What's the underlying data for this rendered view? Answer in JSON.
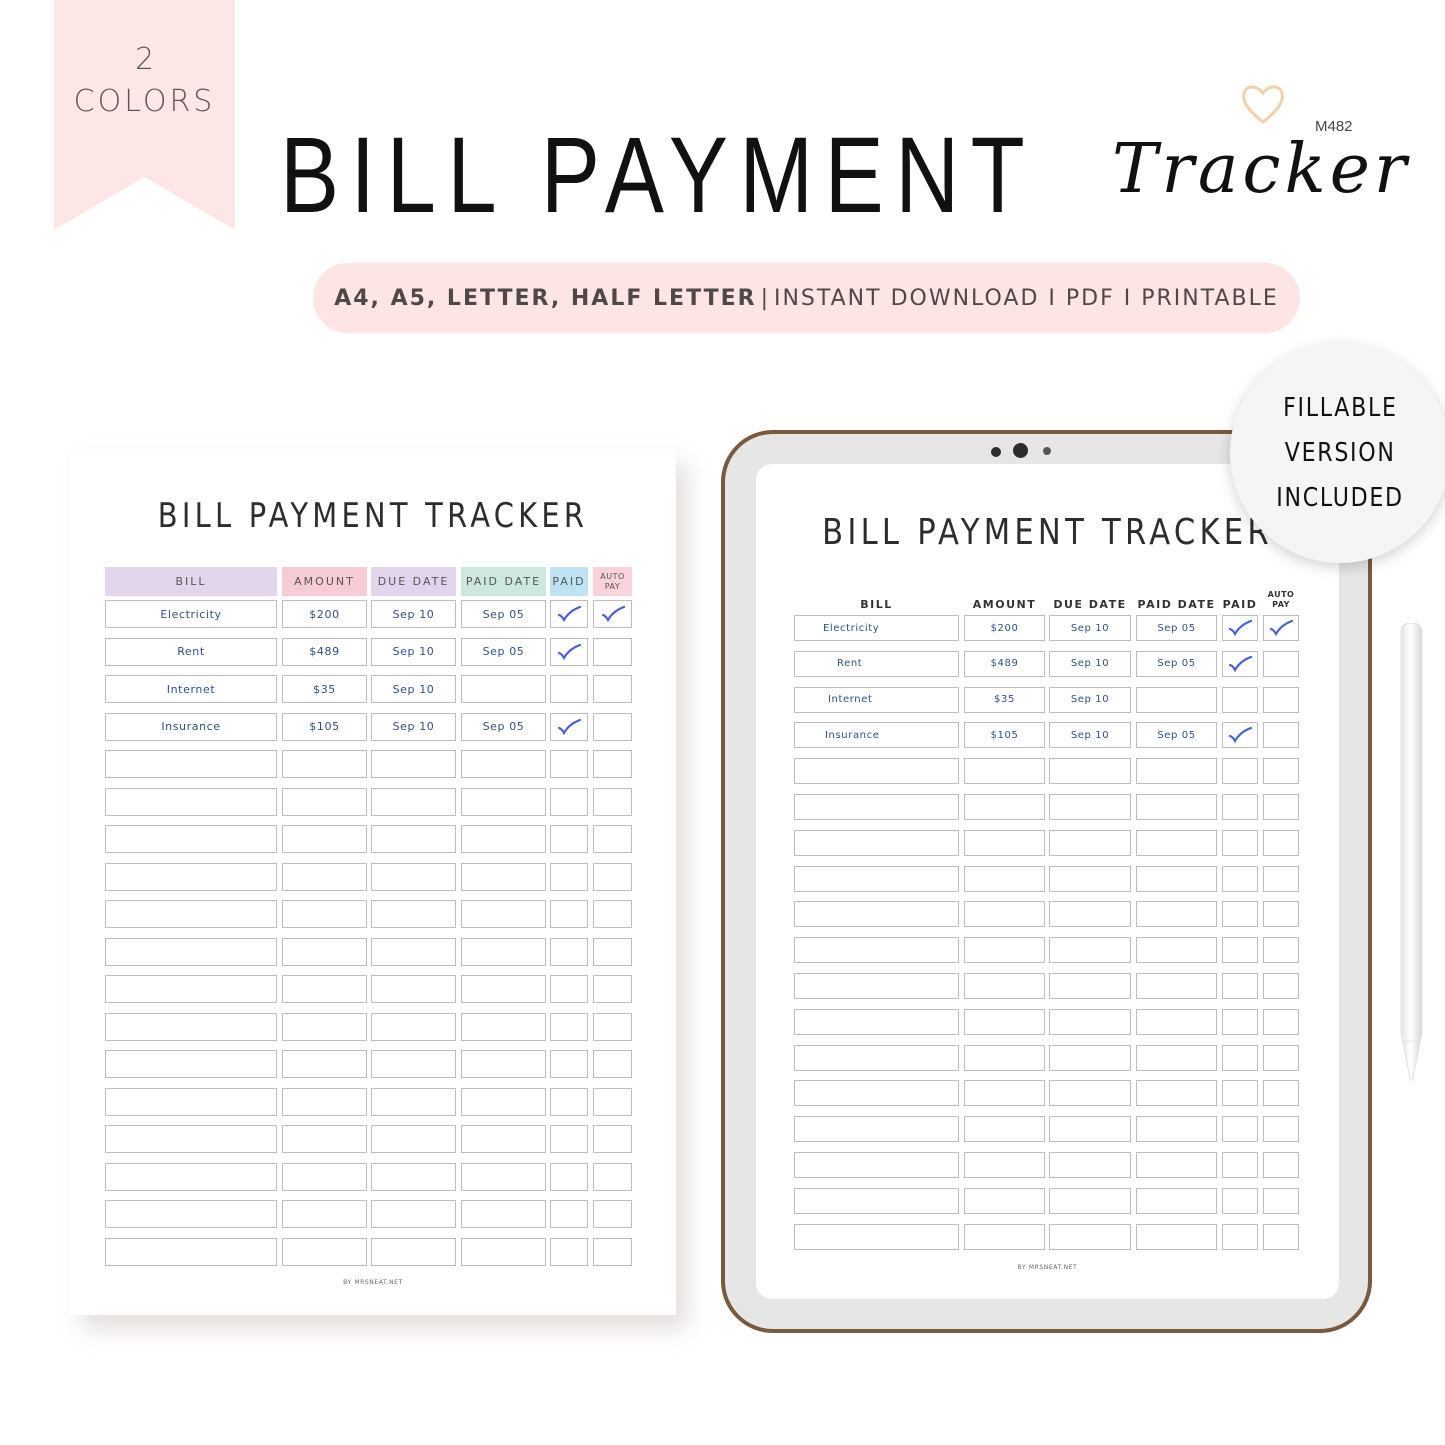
{
  "ribbon": {
    "count": "2",
    "label": "COLORS"
  },
  "header": {
    "title_main": "BILL  PAYMENT",
    "title_script": "Tracker",
    "product_code": "M482",
    "heart_icon": "heart-icon"
  },
  "formats_pill": {
    "sizes": "A4, A5, LETTER, HALF LETTER",
    "divider": "|",
    "rest": "INSTANT DOWNLOAD I PDF I PRINTABLE"
  },
  "sticker": {
    "lines": [
      "FILLABLE",
      "VERSION",
      "INCLUDED"
    ]
  },
  "colors": {
    "ribbon": "#fde7e6",
    "pill": "#fde5e3",
    "tablet_frame": "#7a5a3f",
    "tablet_bezel": "#e6e6e6",
    "header_bill": "#e3d5ec",
    "header_amount": "#f8ccd6",
    "header_due": "#e2d4ec",
    "header_paid_date": "#cfe7e1",
    "header_paid": "#bfe3f2",
    "header_auto": "#f9d3db",
    "entry_text": "#2f4f8a",
    "check": "#4a5fd6"
  },
  "printable": {
    "title": "BILL PAYMENT TRACKER",
    "columns": [
      "BILL",
      "AMOUNT",
      "DUE DATE",
      "PAID DATE",
      "PAID",
      "AUTO PAY"
    ],
    "rows": [
      {
        "bill": "Electricity",
        "amount": "$200",
        "due": "Sep 10",
        "paid_date": "Sep 05",
        "paid": true,
        "auto": true
      },
      {
        "bill": "Rent",
        "amount": "$489",
        "due": "Sep 10",
        "paid_date": "Sep 05",
        "paid": true,
        "auto": false
      },
      {
        "bill": "Internet",
        "amount": "$35",
        "due": "Sep 10",
        "paid_date": "",
        "paid": false,
        "auto": false
      },
      {
        "bill": "Insurance",
        "amount": "$105",
        "due": "Sep 10",
        "paid_date": "Sep 05",
        "paid": true,
        "auto": false
      }
    ],
    "empty_rows": 14,
    "footer": "BY MRSNEAT.NET"
  },
  "tablet": {
    "title": "BILL PAYMENT TRACKER",
    "columns": [
      "BILL",
      "AMOUNT",
      "DUE DATE",
      "PAID DATE",
      "PAID",
      "AUTO PAY"
    ],
    "rows": [
      {
        "bill": "Electricity",
        "amount": "$200",
        "due": "Sep 10",
        "paid_date": "Sep 05",
        "paid": true,
        "auto": true
      },
      {
        "bill": "Rent",
        "amount": "$489",
        "due": "Sep 10",
        "paid_date": "Sep 05",
        "paid": true,
        "auto": false
      },
      {
        "bill": "Internet",
        "amount": "$35",
        "due": "Sep 10",
        "paid_date": "",
        "paid": false,
        "auto": false
      },
      {
        "bill": "Insurance",
        "amount": "$105",
        "due": "Sep 10",
        "paid_date": "Sep 05",
        "paid": true,
        "auto": false
      }
    ],
    "empty_rows": 14,
    "footer": "BY MRSNEAT.NET"
  }
}
